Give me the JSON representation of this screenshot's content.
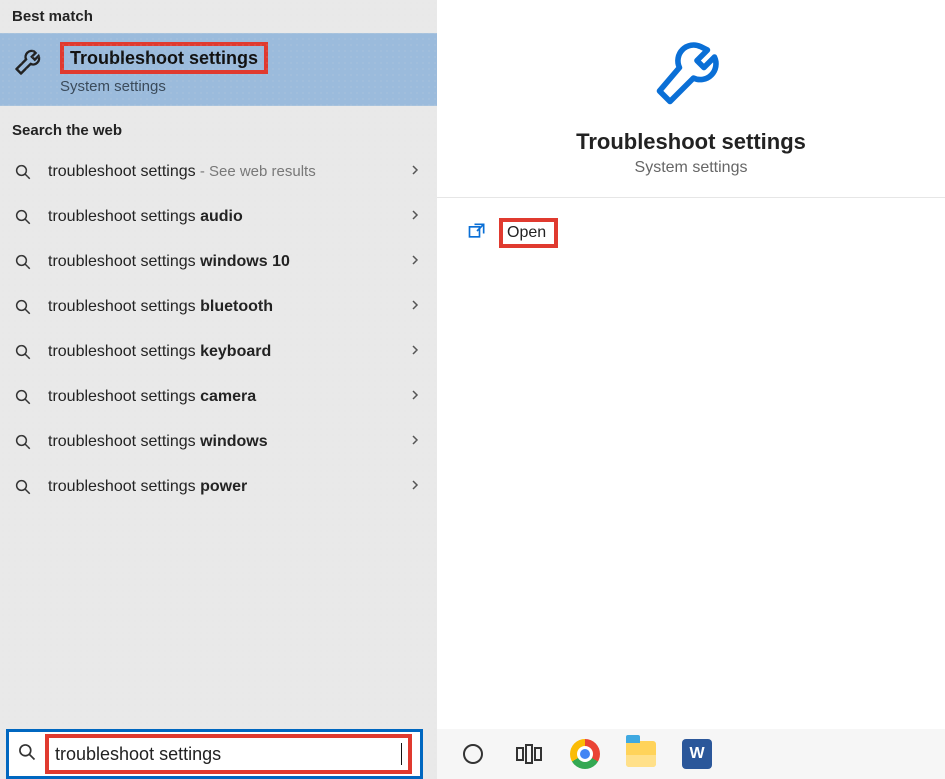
{
  "sections": {
    "best_match_label": "Best match",
    "search_web_label": "Search the web"
  },
  "best_match": {
    "title": "Troubleshoot settings",
    "subtitle": "System settings"
  },
  "web_results": [
    {
      "prefix": "troubleshoot settings",
      "bold": "",
      "suffix": " - See web results"
    },
    {
      "prefix": "troubleshoot settings ",
      "bold": "audio",
      "suffix": ""
    },
    {
      "prefix": "troubleshoot settings ",
      "bold": "windows 10",
      "suffix": ""
    },
    {
      "prefix": "troubleshoot settings ",
      "bold": "bluetooth",
      "suffix": ""
    },
    {
      "prefix": "troubleshoot settings ",
      "bold": "keyboard",
      "suffix": ""
    },
    {
      "prefix": "troubleshoot settings ",
      "bold": "camera",
      "suffix": ""
    },
    {
      "prefix": "troubleshoot settings ",
      "bold": "windows",
      "suffix": ""
    },
    {
      "prefix": "troubleshoot settings ",
      "bold": "power",
      "suffix": ""
    }
  ],
  "preview": {
    "title": "Troubleshoot settings",
    "subtitle": "System settings",
    "open_label": "Open"
  },
  "search": {
    "value": "troubleshoot settings"
  },
  "taskbar": {
    "word_glyph": "W"
  }
}
